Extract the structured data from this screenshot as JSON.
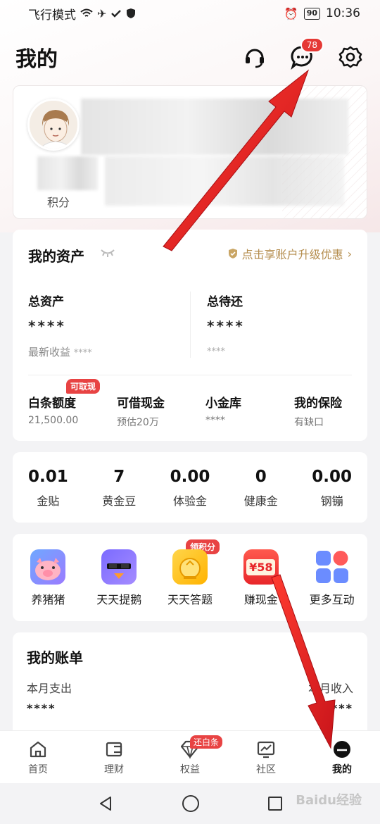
{
  "status_bar": {
    "left_text": "飞行模式",
    "battery": "90",
    "time": "10:36"
  },
  "header": {
    "title": "我的",
    "message_badge": "78",
    "icons": [
      "headset-icon",
      "message-icon",
      "settings-icon"
    ]
  },
  "profile": {
    "points_label": "积分"
  },
  "assets": {
    "title": "我的资产",
    "upgrade_text": "点击享账户升级优惠",
    "total_assets": {
      "label": "总资产",
      "value": "****",
      "sub_label": "最新收益",
      "sub_value": "****"
    },
    "total_due": {
      "label": "总待还",
      "value": "****",
      "sub_value": "****"
    },
    "items": [
      {
        "label": "白条额度",
        "sub": "21,500.00",
        "tag": "可取现"
      },
      {
        "label": "可借现金",
        "sub": "预估20万"
      },
      {
        "label": "小金库",
        "sub": "****"
      },
      {
        "label": "我的保险",
        "sub": "有缺口"
      }
    ]
  },
  "stats": [
    {
      "value": "0.01",
      "label": "金贴"
    },
    {
      "value": "7",
      "label": "黄金豆"
    },
    {
      "value": "0.00",
      "label": "体验金"
    },
    {
      "value": "0",
      "label": "健康金"
    },
    {
      "value": "0.00",
      "label": "钢镚"
    }
  ],
  "games": [
    {
      "label": "养猪猪",
      "icon": "pig-icon"
    },
    {
      "label": "天天提鹅",
      "icon": "goose-icon"
    },
    {
      "label": "天天答题",
      "icon": "quiz-icon",
      "tag": "领积分"
    },
    {
      "label": "赚现金",
      "icon": "cash-envelope-icon",
      "icon_text": "¥58"
    },
    {
      "label": "更多互动",
      "icon": "more-grid-icon"
    }
  ],
  "bill": {
    "title": "我的账单",
    "expense_label": "本月支出",
    "expense_value": "****",
    "income_label": "本月收入",
    "income_value": "****"
  },
  "tabs": [
    {
      "label": "首页",
      "icon": "home-icon"
    },
    {
      "label": "理财",
      "icon": "wallet-icon"
    },
    {
      "label": "权益",
      "icon": "diamond-icon",
      "badge": "还白条"
    },
    {
      "label": "社区",
      "icon": "community-icon"
    },
    {
      "label": "我的",
      "icon": "profile-icon",
      "active": true
    }
  ],
  "watermark": "Baidu经验",
  "colors": {
    "accent_red": "#e84343",
    "gold": "#b48c4c",
    "arrow_red": "#e8262a"
  }
}
